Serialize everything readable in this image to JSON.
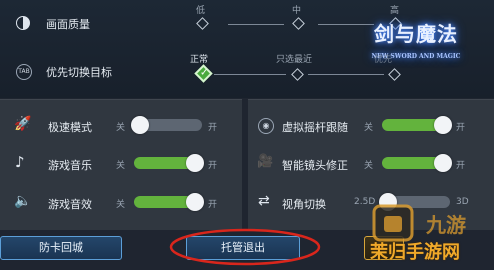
{
  "quality": {
    "label": "画面质量",
    "options": [
      "低",
      "中",
      "高"
    ],
    "selected_index": 3
  },
  "priority": {
    "label": "优先切换目标",
    "tab_icon_text": "TAB",
    "options": [
      "正常",
      "只选最近",
      "优先"
    ],
    "selected_index": 0
  },
  "left_settings": [
    {
      "label": "极速模式",
      "icon": "rocket-icon",
      "off": "关",
      "on": "开",
      "value": false
    },
    {
      "label": "游戏音乐",
      "icon": "music-note-icon",
      "off": "关",
      "on": "开",
      "value": true
    },
    {
      "label": "游戏音效",
      "icon": "speaker-icon",
      "off": "关",
      "on": "开",
      "value": true
    }
  ],
  "right_settings": [
    {
      "label": "虚拟摇杆跟随",
      "icon": "joystick-icon",
      "off": "关",
      "on": "开",
      "value": true
    },
    {
      "label": "智能镜头修正",
      "icon": "camera-icon",
      "off": "关",
      "on": "开",
      "value": true
    },
    {
      "label": "视角切换",
      "icon": "switch-view-icon",
      "off": "2.5D",
      "on": "3D",
      "value": false
    }
  ],
  "buttons": {
    "anti_stuck": "防卡回城",
    "exit_auto": "托管退出"
  },
  "logo": {
    "text": "剑与魔法",
    "sub": "NEW SWORD AND MAGIC"
  },
  "watermark": {
    "text": "茉归手游网"
  },
  "colors": {
    "accent_green": "#63b33d",
    "button_border": "#5c9fd8",
    "highlight_red": "#d9261c"
  }
}
